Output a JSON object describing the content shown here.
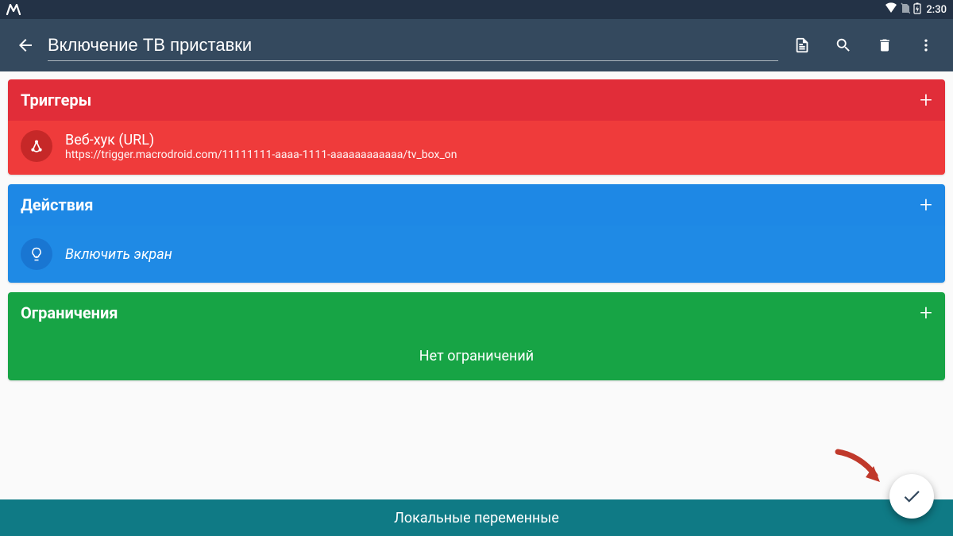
{
  "statusbar": {
    "time": "2:30"
  },
  "appbar": {
    "title_value": "Включение ТВ приставки"
  },
  "triggers": {
    "title": "Триггеры",
    "item": {
      "primary": "Веб-хук (URL)",
      "secondary": "https://trigger.macrodroid.com/11111111-aaaa-1111-aaaaaaaaaaaa/tv_box_on"
    }
  },
  "actions": {
    "title": "Действия",
    "item": {
      "primary": "Включить экран"
    }
  },
  "constraints": {
    "title": "Ограничения",
    "empty_text": "Нет ограничений"
  },
  "bottom_bar": {
    "label": "Локальные переменные"
  }
}
